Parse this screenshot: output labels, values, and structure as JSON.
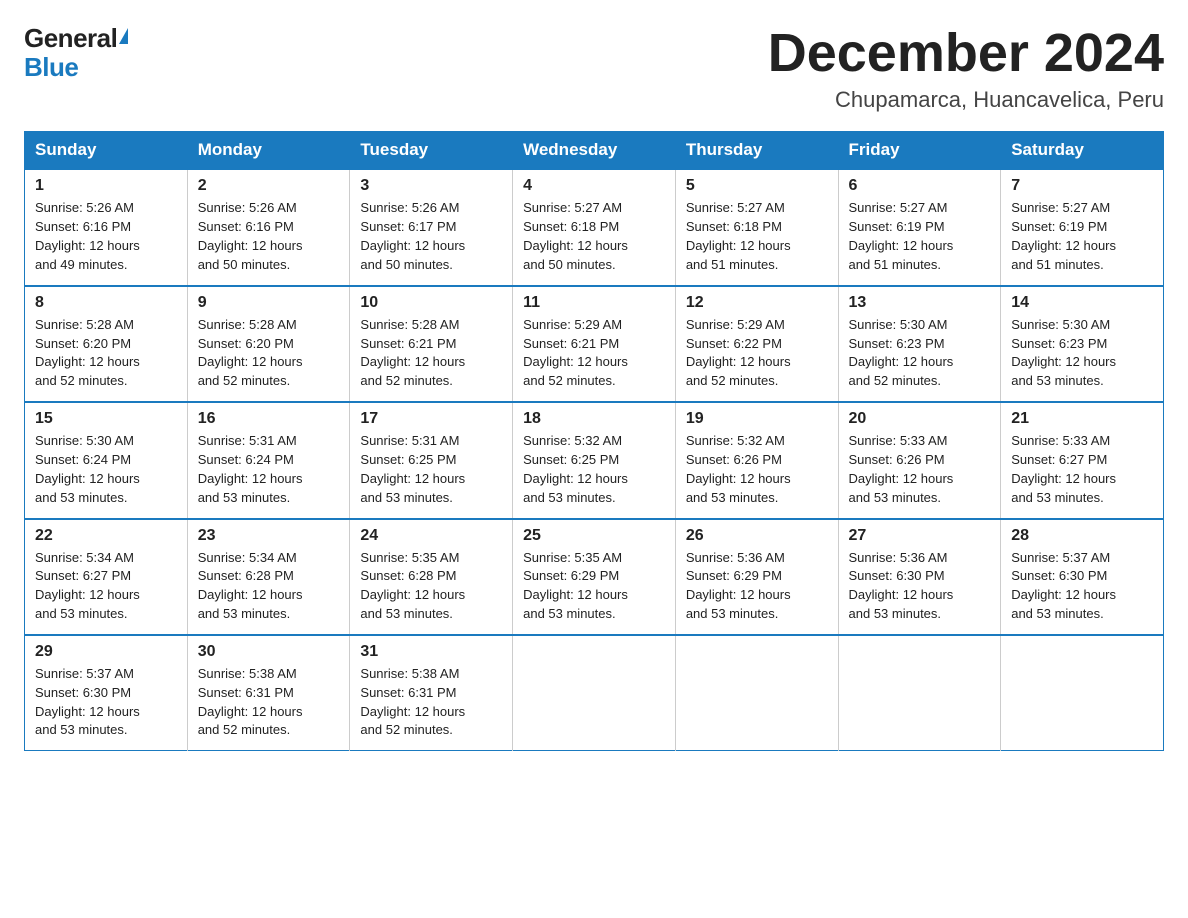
{
  "logo": {
    "general": "General",
    "blue": "Blue"
  },
  "title": {
    "month": "December 2024",
    "location": "Chupamarca, Huancavelica, Peru"
  },
  "weekdays": [
    "Sunday",
    "Monday",
    "Tuesday",
    "Wednesday",
    "Thursday",
    "Friday",
    "Saturday"
  ],
  "weeks": [
    [
      {
        "day": "1",
        "sunrise": "5:26 AM",
        "sunset": "6:16 PM",
        "daylight": "12 hours and 49 minutes."
      },
      {
        "day": "2",
        "sunrise": "5:26 AM",
        "sunset": "6:16 PM",
        "daylight": "12 hours and 50 minutes."
      },
      {
        "day": "3",
        "sunrise": "5:26 AM",
        "sunset": "6:17 PM",
        "daylight": "12 hours and 50 minutes."
      },
      {
        "day": "4",
        "sunrise": "5:27 AM",
        "sunset": "6:18 PM",
        "daylight": "12 hours and 50 minutes."
      },
      {
        "day": "5",
        "sunrise": "5:27 AM",
        "sunset": "6:18 PM",
        "daylight": "12 hours and 51 minutes."
      },
      {
        "day": "6",
        "sunrise": "5:27 AM",
        "sunset": "6:19 PM",
        "daylight": "12 hours and 51 minutes."
      },
      {
        "day": "7",
        "sunrise": "5:27 AM",
        "sunset": "6:19 PM",
        "daylight": "12 hours and 51 minutes."
      }
    ],
    [
      {
        "day": "8",
        "sunrise": "5:28 AM",
        "sunset": "6:20 PM",
        "daylight": "12 hours and 52 minutes."
      },
      {
        "day": "9",
        "sunrise": "5:28 AM",
        "sunset": "6:20 PM",
        "daylight": "12 hours and 52 minutes."
      },
      {
        "day": "10",
        "sunrise": "5:28 AM",
        "sunset": "6:21 PM",
        "daylight": "12 hours and 52 minutes."
      },
      {
        "day": "11",
        "sunrise": "5:29 AM",
        "sunset": "6:21 PM",
        "daylight": "12 hours and 52 minutes."
      },
      {
        "day": "12",
        "sunrise": "5:29 AM",
        "sunset": "6:22 PM",
        "daylight": "12 hours and 52 minutes."
      },
      {
        "day": "13",
        "sunrise": "5:30 AM",
        "sunset": "6:23 PM",
        "daylight": "12 hours and 52 minutes."
      },
      {
        "day": "14",
        "sunrise": "5:30 AM",
        "sunset": "6:23 PM",
        "daylight": "12 hours and 53 minutes."
      }
    ],
    [
      {
        "day": "15",
        "sunrise": "5:30 AM",
        "sunset": "6:24 PM",
        "daylight": "12 hours and 53 minutes."
      },
      {
        "day": "16",
        "sunrise": "5:31 AM",
        "sunset": "6:24 PM",
        "daylight": "12 hours and 53 minutes."
      },
      {
        "day": "17",
        "sunrise": "5:31 AM",
        "sunset": "6:25 PM",
        "daylight": "12 hours and 53 minutes."
      },
      {
        "day": "18",
        "sunrise": "5:32 AM",
        "sunset": "6:25 PM",
        "daylight": "12 hours and 53 minutes."
      },
      {
        "day": "19",
        "sunrise": "5:32 AM",
        "sunset": "6:26 PM",
        "daylight": "12 hours and 53 minutes."
      },
      {
        "day": "20",
        "sunrise": "5:33 AM",
        "sunset": "6:26 PM",
        "daylight": "12 hours and 53 minutes."
      },
      {
        "day": "21",
        "sunrise": "5:33 AM",
        "sunset": "6:27 PM",
        "daylight": "12 hours and 53 minutes."
      }
    ],
    [
      {
        "day": "22",
        "sunrise": "5:34 AM",
        "sunset": "6:27 PM",
        "daylight": "12 hours and 53 minutes."
      },
      {
        "day": "23",
        "sunrise": "5:34 AM",
        "sunset": "6:28 PM",
        "daylight": "12 hours and 53 minutes."
      },
      {
        "day": "24",
        "sunrise": "5:35 AM",
        "sunset": "6:28 PM",
        "daylight": "12 hours and 53 minutes."
      },
      {
        "day": "25",
        "sunrise": "5:35 AM",
        "sunset": "6:29 PM",
        "daylight": "12 hours and 53 minutes."
      },
      {
        "day": "26",
        "sunrise": "5:36 AM",
        "sunset": "6:29 PM",
        "daylight": "12 hours and 53 minutes."
      },
      {
        "day": "27",
        "sunrise": "5:36 AM",
        "sunset": "6:30 PM",
        "daylight": "12 hours and 53 minutes."
      },
      {
        "day": "28",
        "sunrise": "5:37 AM",
        "sunset": "6:30 PM",
        "daylight": "12 hours and 53 minutes."
      }
    ],
    [
      {
        "day": "29",
        "sunrise": "5:37 AM",
        "sunset": "6:30 PM",
        "daylight": "12 hours and 53 minutes."
      },
      {
        "day": "30",
        "sunrise": "5:38 AM",
        "sunset": "6:31 PM",
        "daylight": "12 hours and 52 minutes."
      },
      {
        "day": "31",
        "sunrise": "5:38 AM",
        "sunset": "6:31 PM",
        "daylight": "12 hours and 52 minutes."
      },
      null,
      null,
      null,
      null
    ]
  ],
  "labels": {
    "sunrise": "Sunrise:",
    "sunset": "Sunset:",
    "daylight": "Daylight:"
  }
}
